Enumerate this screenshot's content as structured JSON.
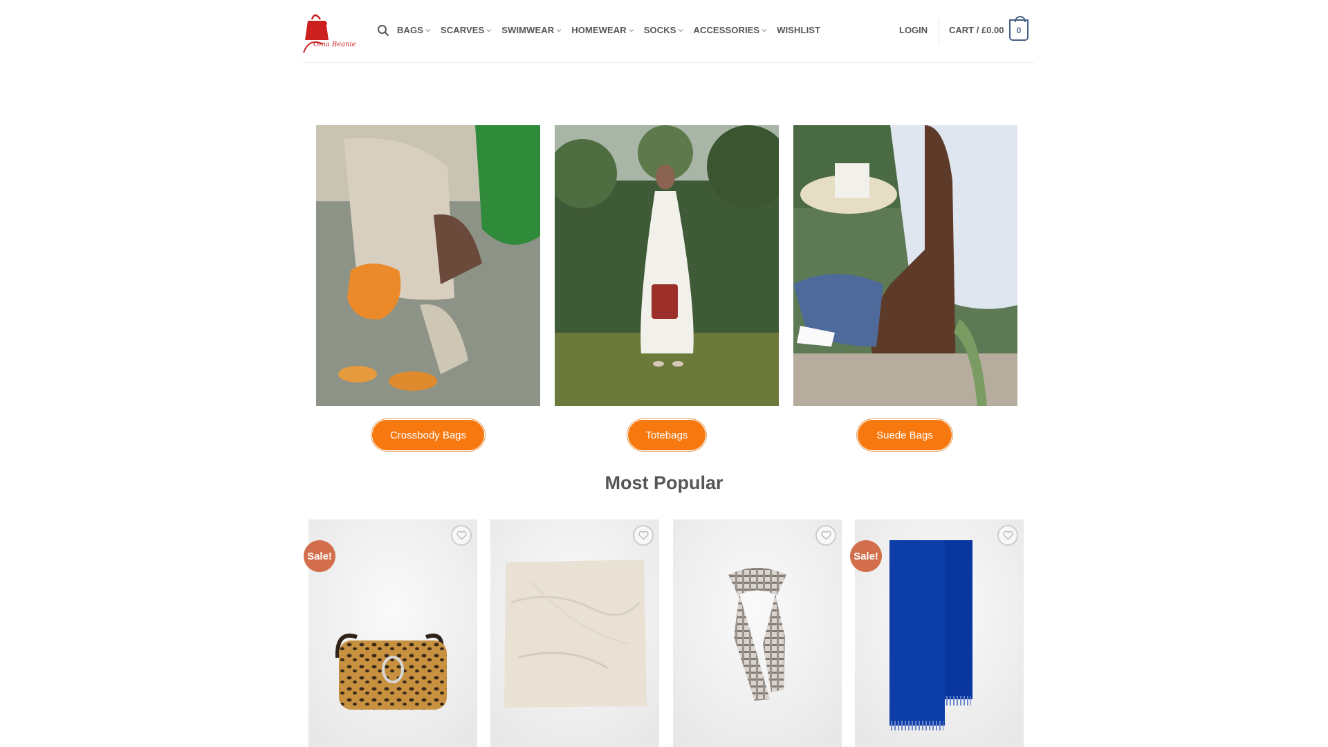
{
  "brand": {
    "logo_text": "Oma Beanie",
    "accent_red": "#cc1f1f"
  },
  "header": {
    "nav": [
      {
        "label": "BAGS",
        "has_dropdown": true
      },
      {
        "label": "SCARVES",
        "has_dropdown": true
      },
      {
        "label": "SWIMWEAR",
        "has_dropdown": true
      },
      {
        "label": "HOMEWEAR",
        "has_dropdown": true
      },
      {
        "label": "SOCKS",
        "has_dropdown": true
      },
      {
        "label": "ACCESSORIES",
        "has_dropdown": true
      },
      {
        "label": "WISHLIST",
        "has_dropdown": false
      }
    ],
    "login_label": "LOGIN",
    "cart_label": "CART / £0.00",
    "cart_count": "0",
    "icons": [
      "search-icon",
      "chevron-down-icon",
      "cart-bag-icon"
    ]
  },
  "categories": [
    {
      "button_label": "Crossbody Bags",
      "image": "woman-with-orange-crossbody-bag-photo"
    },
    {
      "button_label": "Totebags",
      "image": "woman-in-white-dress-with-red-tote-photo"
    },
    {
      "button_label": "Suede Bags",
      "image": "person-with-brown-suede-bag-photo"
    }
  ],
  "button_color": "#f7780f",
  "popular": {
    "title": "Most Popular",
    "products": [
      {
        "image": "leopard-print-crossbody-bag",
        "sale_badge": "Sale!"
      },
      {
        "image": "cream-wool-scarf",
        "sale_badge": ""
      },
      {
        "image": "grey-check-neck-scarf",
        "sale_badge": ""
      },
      {
        "image": "cobalt-blue-fringed-scarf",
        "sale_badge": "Sale!"
      }
    ],
    "sale_color": "#d26e4b",
    "wishlist_icon": "heart-icon"
  }
}
